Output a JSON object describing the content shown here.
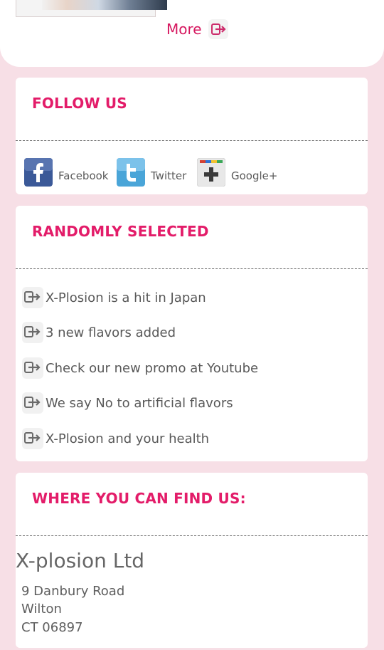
{
  "top": {
    "more_label": "More"
  },
  "follow": {
    "title": "FOLLOW US",
    "links": [
      {
        "label": "Facebook",
        "icon": "facebook-icon",
        "color": "#3b5998"
      },
      {
        "label": "Twitter",
        "icon": "twitter-icon",
        "color": "#4aa5d8"
      },
      {
        "label": "Google+",
        "icon": "google-plus-icon",
        "color": "#e6e6e6"
      }
    ]
  },
  "random": {
    "title": "RANDOMLY SELECTED",
    "items": [
      {
        "label": "X-Plosion is a hit in Japan"
      },
      {
        "label": "3 new flavors added"
      },
      {
        "label": "Check our new promo at Youtube"
      },
      {
        "label": "We say No to artificial flavors"
      },
      {
        "label": "X-Plosion and your health"
      }
    ]
  },
  "find": {
    "title": "WHERE YOU CAN FIND US:",
    "company": "X-plosion Ltd",
    "address": [
      "9 Danbury Road",
      "Wilton",
      "CT 06897"
    ]
  },
  "colors": {
    "accent": "#e31c69",
    "background": "#f7dfe6",
    "panel": "#ffffff"
  }
}
